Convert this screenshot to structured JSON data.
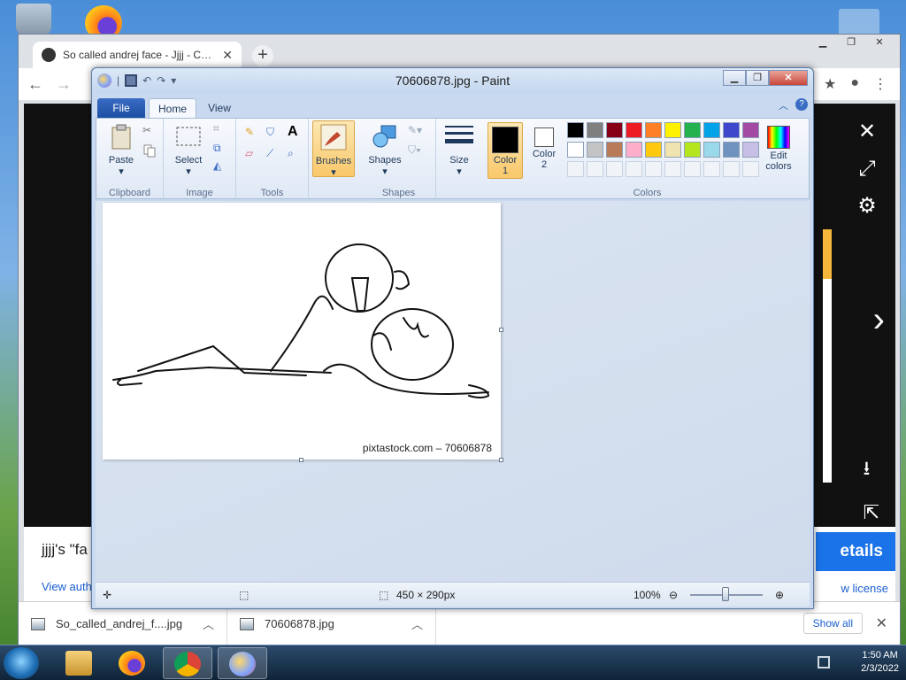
{
  "browser": {
    "tab_title": "So called andrej face - Jjjj - Com",
    "page_title": "jjjj's \"fa",
    "details_label": "etails",
    "view_author": "View auth",
    "view_license": "w license",
    "downloads": [
      {
        "name": "So_called_andrej_f....jpg"
      },
      {
        "name": "70606878.jpg"
      }
    ],
    "show_all": "Show all"
  },
  "paint": {
    "title": "70606878.jpg - Paint",
    "tabs": {
      "file": "File",
      "home": "Home",
      "view": "View"
    },
    "groups": {
      "clipboard": "Clipboard",
      "image": "Image",
      "tools": "Tools",
      "shapes": "Shapes",
      "colors": "Colors"
    },
    "buttons": {
      "paste": "Paste",
      "select": "Select",
      "brushes": "Brushes",
      "shapes": "Shapes",
      "size": "Size",
      "color1": "Color\n1",
      "color1_a": "Color",
      "color1_b": "1",
      "color2_a": "Color",
      "color2_b": "2",
      "edit_colors_a": "Edit",
      "edit_colors_b": "colors"
    },
    "palette_row1": [
      "#000000",
      "#7f7f7f",
      "#880015",
      "#ed1c24",
      "#ff7f27",
      "#fff200",
      "#22b14c",
      "#00a2e8",
      "#3f48cc",
      "#a349a4"
    ],
    "palette_row2": [
      "#ffffff",
      "#c3c3c3",
      "#b97a57",
      "#ffaec9",
      "#ffc90e",
      "#efe4b0",
      "#b5e61d",
      "#99d9ea",
      "#7092be",
      "#c8bfe7"
    ],
    "color1_value": "#000000",
    "color2_value": "#ffffff",
    "watermark": "pixtastock.com – 70606878",
    "status": {
      "dimensions": "450 × 290px",
      "zoom": "100%"
    }
  },
  "taskbar": {
    "time": "1:50 AM",
    "date": "2/3/2022"
  }
}
